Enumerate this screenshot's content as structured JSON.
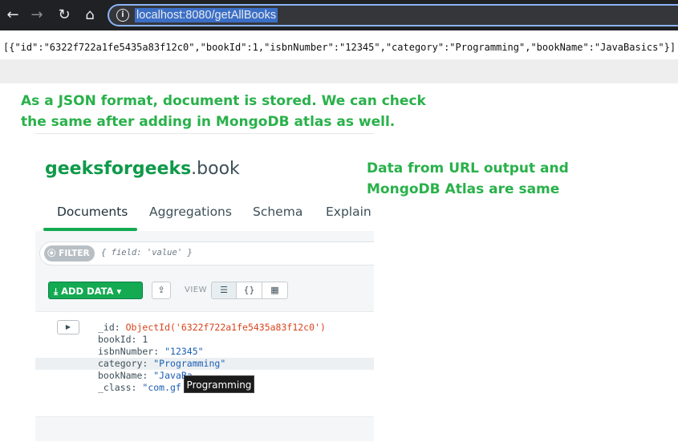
{
  "browser": {
    "url": "localhost:8080/getAllBooks"
  },
  "response": {
    "json_text": "[{\"id\":\"6322f722a1fe5435a83f12c0\",\"bookId\":1,\"isbnNumber\":\"12345\",\"category\":\"Programming\",\"bookName\":\"JavaBasics\"}]"
  },
  "notes": {
    "top": "As a JSON format, document is stored. We can check the same after adding in MongoDB atlas as well.",
    "right": "Data from URL output and MongoDB Atlas are same"
  },
  "atlas": {
    "database": "geeksforgeeks",
    "collection": ".book",
    "tabs": [
      "Documents",
      "Aggregations",
      "Schema",
      "Explain"
    ],
    "filter_label": "FILTER",
    "filter_placeholder": "{ field: 'value' }",
    "add_data_label": "ADD DATA",
    "view_label": "VIEW",
    "document": {
      "fields": [
        {
          "key": "_id: ",
          "value": "ObjectId('6322f722a1fe5435a83f12c0')",
          "kind": "oid"
        },
        {
          "key": "bookId: ",
          "value": "1",
          "kind": "num"
        },
        {
          "key": "isbnNumber: ",
          "value": "\"12345\"",
          "kind": "str"
        },
        {
          "key": "category: ",
          "value": "\"Programming\"",
          "kind": "str"
        },
        {
          "key": "bookName: ",
          "value": "\"JavaBa",
          "kind": "str"
        },
        {
          "key": "_class: ",
          "value": "\"com.gf",
          "kind": "str"
        }
      ]
    },
    "tooltip": "Programming"
  },
  "colors": {
    "note_green": "#29b14a",
    "brand_green": "#13aa52",
    "objectid_red": "#d9441c",
    "string_blue": "#1a5fb4"
  }
}
